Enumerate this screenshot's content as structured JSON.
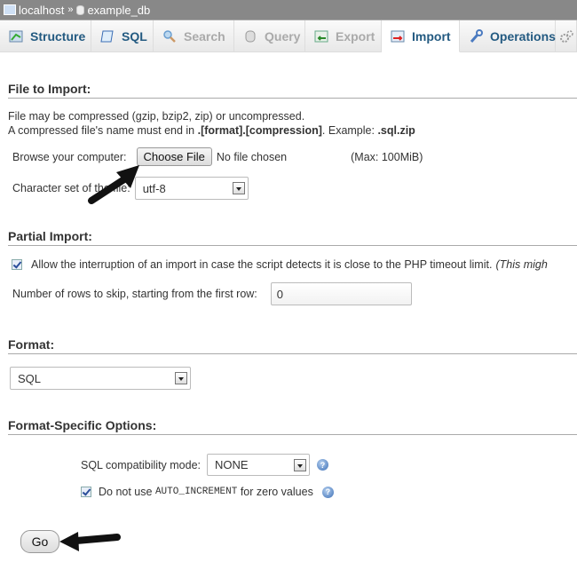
{
  "breadcrumb": {
    "server": "localhost",
    "separator": "»",
    "database": "example_db"
  },
  "tabs": [
    {
      "label": "Structure",
      "icon": "structure-icon",
      "state": "normal"
    },
    {
      "label": "SQL",
      "icon": "sql-icon",
      "state": "normal"
    },
    {
      "label": "Search",
      "icon": "search-icon",
      "state": "disabled"
    },
    {
      "label": "Query",
      "icon": "query-icon",
      "state": "disabled"
    },
    {
      "label": "Export",
      "icon": "export-icon",
      "state": "disabled"
    },
    {
      "label": "Import",
      "icon": "import-icon",
      "state": "active"
    },
    {
      "label": "Operations",
      "icon": "operations-icon",
      "state": "normal"
    }
  ],
  "file_import": {
    "heading": "File to Import:",
    "line1": "File may be compressed (gzip, bzip2, zip) or uncompressed.",
    "line2_pre": "A compressed file's name must end in ",
    "line2_bold": ".[format].[compression]",
    "line2_mid": ". Example: ",
    "line2_example": ".sql.zip",
    "browse_label": "Browse your computer:",
    "choose_button": "Choose File",
    "no_file": "No file chosen",
    "max_size": "(Max: 100MiB)",
    "charset_label": "Character set of the file:",
    "charset_value": "utf-8"
  },
  "partial_import": {
    "heading": "Partial Import:",
    "allow_interrupt_checked": true,
    "allow_interrupt_label": "Allow the interruption of an import in case the script detects it is close to the PHP timeout limit.",
    "allow_interrupt_note": "(This migh",
    "skip_rows_label": "Number of rows to skip, starting from the first row:",
    "skip_rows_value": "0"
  },
  "format": {
    "heading": "Format:",
    "value": "SQL"
  },
  "format_options": {
    "heading": "Format-Specific Options:",
    "compat_label": "SQL compatibility mode:",
    "compat_value": "NONE",
    "no_auto_inc_checked": true,
    "no_auto_inc_pre": "Do not use ",
    "no_auto_inc_code": "AUTO_INCREMENT",
    "no_auto_inc_post": " for zero values"
  },
  "go_button": "Go"
}
